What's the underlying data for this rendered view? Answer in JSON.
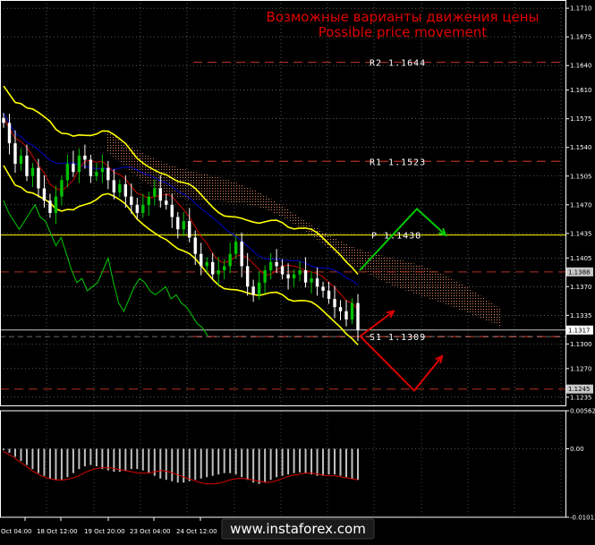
{
  "title_ru": "Возможные варианты движения цены",
  "title_en": "Possible price movement",
  "watermark": "www.instaforex.com",
  "colors": {
    "background": "#000000",
    "grid": "#ffffff",
    "axis": "#ffffff",
    "bull_candle": "#00c000",
    "bear_candle": "#ffffff",
    "bollinger": "#ffff00",
    "kijun": "#0000cc",
    "tenkan": "#cc0000",
    "chikou": "#00cc00",
    "cloud": "#ff9966",
    "level_line": "#b03020",
    "current_line": "#c8c8c8",
    "pivot_line": "#ffff00",
    "up_arrow": "#00cc00",
    "down_arrow": "#dd0000",
    "histogram": "#c0c0c0",
    "signal": "#dd0000"
  },
  "chart_data": [
    {
      "type": "candlestick",
      "symbol_note": "price panel",
      "y_ticks": [
        "1.1710",
        "1.1675",
        "1.1640",
        "1.1610",
        "1.1575",
        "1.1540",
        "1.1505",
        "1.1470",
        "1.1435",
        "1.1405",
        "1.1370",
        "1.1335",
        "1.1300",
        "1.1270",
        "1.1235"
      ],
      "ylim": [
        1.1225,
        1.172
      ],
      "x_ticks": [
        "Oct 04:00",
        "18 Oct 12:00",
        "19 Oct 20:00",
        "23 Oct 04:00",
        "24 Oct 12:00"
      ],
      "levels": [
        {
          "name": "R2",
          "label": "R2 1.1644",
          "value": 1.1644
        },
        {
          "name": "R1",
          "label": "R1 1.1523",
          "value": 1.1523
        },
        {
          "name": "P",
          "label": "P 1.1438",
          "value": 1.1433
        },
        {
          "name": "S1",
          "label": "S1 1.1309",
          "value": 1.1309
        }
      ],
      "price_tags": [
        {
          "label": "1.1388",
          "value": 1.1388,
          "style": "tag-light"
        },
        {
          "label": "1.1317",
          "value": 1.1317,
          "style": "tag-white"
        },
        {
          "label": "1.1245",
          "value": 1.1245,
          "style": "tag-light"
        }
      ],
      "scenarios": [
        {
          "name": "up",
          "points": [
            [
              1.139,
              0
            ],
            [
              1.1465,
              1
            ],
            [
              1.1438,
              2
            ]
          ]
        },
        {
          "name": "down-then-up",
          "points": [
            [
              1.131,
              0
            ],
            [
              1.1245,
              1
            ],
            [
              1.1285,
              2
            ]
          ]
        },
        {
          "name": "short-up",
          "points": [
            [
              1.1309,
              0
            ],
            [
              1.134,
              1
            ]
          ]
        }
      ],
      "close_series": [
        1.157,
        1.1545,
        1.152,
        1.153,
        1.1505,
        1.1515,
        1.149,
        1.1475,
        1.146,
        1.148,
        1.15,
        1.152,
        1.151,
        1.153,
        1.1525,
        1.1505,
        1.151,
        1.1515,
        1.15,
        1.1485,
        1.1495,
        1.148,
        1.147,
        1.146,
        1.147,
        1.148,
        1.149,
        1.1475,
        1.147,
        1.1455,
        1.144,
        1.145,
        1.143,
        1.141,
        1.1395,
        1.14,
        1.1385,
        1.139,
        1.1395,
        1.141,
        1.1425,
        1.1395,
        1.137,
        1.136,
        1.1375,
        1.139,
        1.14,
        1.1395,
        1.1385,
        1.138,
        1.1385,
        1.139,
        1.1375,
        1.138,
        1.137,
        1.1365,
        1.1355,
        1.1345,
        1.134,
        1.133,
        1.135,
        1.1317
      ]
    },
    {
      "type": "histogram",
      "symbol_note": "oscillator panel",
      "y_ticks": [
        "0.00562",
        "0.00",
        "-0.01013"
      ],
      "ylim": [
        -0.01013,
        0.00562
      ],
      "values": [
        -0.0002,
        -0.0006,
        -0.0012,
        -0.0018,
        -0.0024,
        -0.003,
        -0.0036,
        -0.004,
        -0.0044,
        -0.0046,
        -0.0046,
        -0.0042,
        -0.0036,
        -0.003,
        -0.0026,
        -0.0024,
        -0.0026,
        -0.003,
        -0.0032,
        -0.0034,
        -0.0034,
        -0.0032,
        -0.003,
        -0.003,
        -0.0032,
        -0.0036,
        -0.004,
        -0.0044,
        -0.0046,
        -0.0048,
        -0.005,
        -0.005,
        -0.0048,
        -0.0046,
        -0.0044,
        -0.0042,
        -0.004,
        -0.0038,
        -0.0036,
        -0.0036,
        -0.0038,
        -0.0042,
        -0.0046,
        -0.005,
        -0.0052,
        -0.005,
        -0.0046,
        -0.0042,
        -0.004,
        -0.0038,
        -0.0036,
        -0.0035,
        -0.0036,
        -0.0038,
        -0.004,
        -0.004,
        -0.0038,
        -0.0038,
        -0.004,
        -0.0042,
        -0.0044,
        -0.0046
      ],
      "signal": [
        -0.0004,
        -0.001,
        -0.0018,
        -0.0026,
        -0.0034,
        -0.004,
        -0.0044,
        -0.0046,
        -0.0046,
        -0.0044,
        -0.004,
        -0.0034,
        -0.003,
        -0.0028,
        -0.0028,
        -0.003,
        -0.0032,
        -0.0034,
        -0.0036,
        -0.0036,
        -0.0034,
        -0.0032,
        -0.0034,
        -0.0038,
        -0.0042,
        -0.0046,
        -0.005,
        -0.0052,
        -0.0052,
        -0.005,
        -0.0046,
        -0.0044,
        -0.0044,
        -0.0046,
        -0.0048,
        -0.005,
        -0.0048,
        -0.0044,
        -0.004,
        -0.0038,
        -0.0036,
        -0.0036,
        -0.0038,
        -0.004,
        -0.004,
        -0.0042,
        -0.0044,
        -0.0046
      ]
    }
  ]
}
